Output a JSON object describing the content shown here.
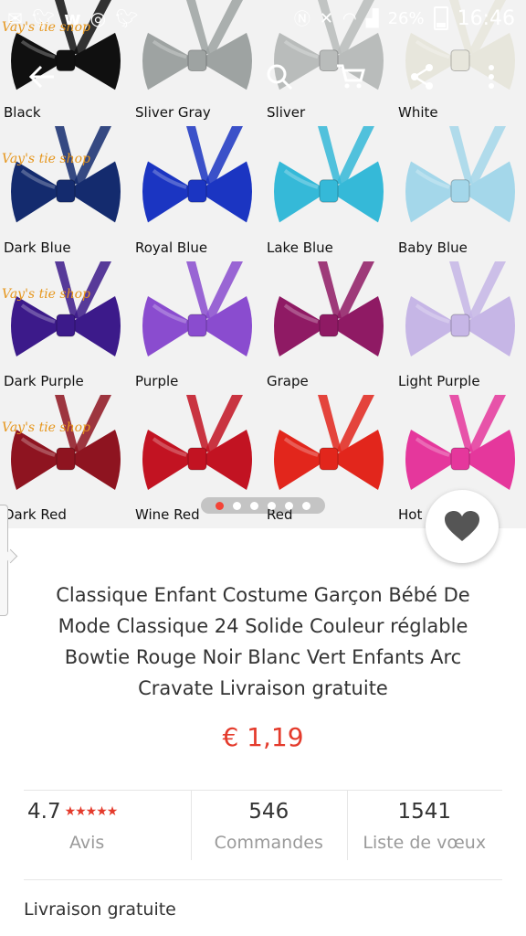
{
  "status_bar": {
    "left_icons": [
      "mail-icon",
      "twitter-icon",
      "w-icon",
      "sync-icon",
      "twitter-icon"
    ],
    "right_icons": [
      "nfc-icon",
      "mute-icon",
      "wifi-icon",
      "signal-icon"
    ],
    "battery": "26%",
    "time": "16:46"
  },
  "toolbar": {
    "icons": [
      "back-arrow-icon",
      "search-icon",
      "cart-icon",
      "share-icon",
      "more-icon"
    ]
  },
  "gallery": {
    "watermark": "Vay's tie shop",
    "items": [
      {
        "label": "Black",
        "color": "#101010"
      },
      {
        "label": "Sliver Gray",
        "color": "#9ea3a2"
      },
      {
        "label": "Sliver",
        "color": "#b9bcbb"
      },
      {
        "label": "White",
        "color": "#e7e6dc"
      },
      {
        "label": "Dark Blue",
        "color": "#142b6e"
      },
      {
        "label": "Royal Blue",
        "color": "#1b35c2"
      },
      {
        "label": "Lake Blue",
        "color": "#35b9d8"
      },
      {
        "label": "Baby Blue",
        "color": "#a4d7ea"
      },
      {
        "label": "Dark Purple",
        "color": "#3c1a8a"
      },
      {
        "label": "Purple",
        "color": "#8a4ccf"
      },
      {
        "label": "Grape",
        "color": "#8f1a64"
      },
      {
        "label": "Light Purple",
        "color": "#c6b6e6"
      },
      {
        "label": "Dark Red",
        "color": "#8e1420"
      },
      {
        "label": "Wine Red",
        "color": "#c21322"
      },
      {
        "label": "Red",
        "color": "#e2261c"
      },
      {
        "label": "Hot",
        "color": "#e5379c"
      }
    ],
    "dot_count": 6,
    "active_index": 0
  },
  "product": {
    "title": "Classique Enfant Costume Garçon Bébé De Mode Classique 24 Solide Couleur réglable Bowtie Rouge Noir Blanc Vert Enfants Arc Cravate Livraison gratuite",
    "price": "€ 1,19"
  },
  "stats": {
    "rating": "4.7",
    "rating_stars": "★★★★★",
    "rating_label": "Avis",
    "orders": "546",
    "orders_label": "Commandes",
    "wishlist": "1541",
    "wishlist_label": "Liste de vœux"
  },
  "shipping": {
    "label": "Livraison gratuite"
  },
  "colors": {
    "accent": "#e43b2c",
    "fav_icon": "#555555"
  }
}
